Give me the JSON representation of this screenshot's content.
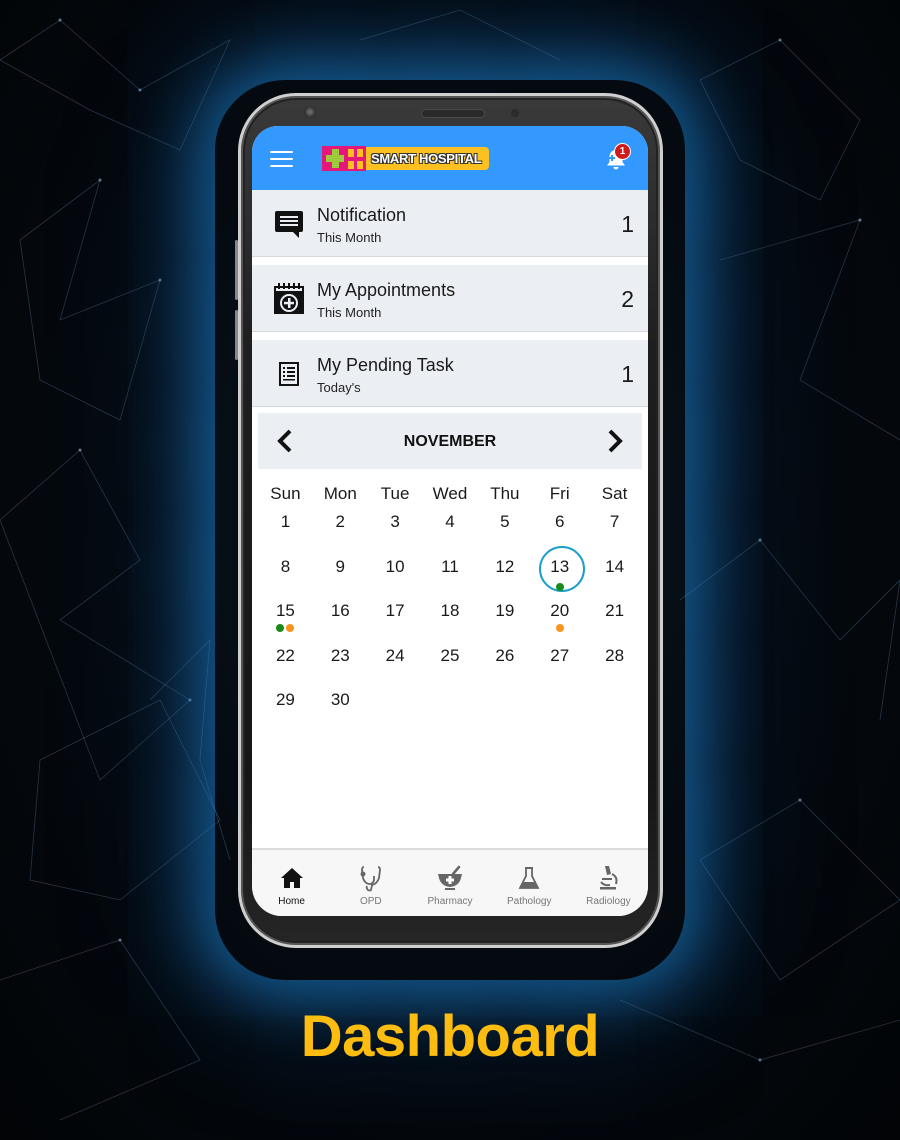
{
  "app": {
    "name": "SMART HOSPITAL",
    "notification_badge": "1",
    "colors": {
      "appbar": "#3399ff",
      "logo_yellow": "#fcc020",
      "logo_pink": "#e6177a",
      "logo_green": "#9ccc3c",
      "caption": "#fcbc10",
      "today_ring": "#1aa0c8",
      "dot_green": "#1a8a1a",
      "dot_orange": "#f7941d"
    }
  },
  "summary_cards": [
    {
      "icon": "chat-message-icon",
      "title": "Notification",
      "subtitle": "This Month",
      "count": "1"
    },
    {
      "icon": "calendar-plus-icon",
      "title": "My Appointments",
      "subtitle": "This Month",
      "count": "2"
    },
    {
      "icon": "task-list-icon",
      "title": "My Pending Task",
      "subtitle": "Today's",
      "count": "1"
    }
  ],
  "calendar": {
    "month": "NOVEMBER",
    "weekdays": [
      "Sun",
      "Mon",
      "Tue",
      "Wed",
      "Thu",
      "Fri",
      "Sat"
    ],
    "first_weekday_index": 0,
    "days_in_month": 30,
    "today": 13,
    "markers": {
      "13": [
        "green"
      ],
      "15": [
        "green",
        "orange"
      ],
      "20": [
        "orange"
      ]
    }
  },
  "bottom_nav": [
    {
      "id": "home",
      "label": "Home",
      "active": true
    },
    {
      "id": "opd",
      "label": "OPD",
      "active": false
    },
    {
      "id": "pharmacy",
      "label": "Pharmacy",
      "active": false
    },
    {
      "id": "pathology",
      "label": "Pathology",
      "active": false
    },
    {
      "id": "radiology",
      "label": "Radiology",
      "active": false
    }
  ],
  "caption": "Dashboard"
}
